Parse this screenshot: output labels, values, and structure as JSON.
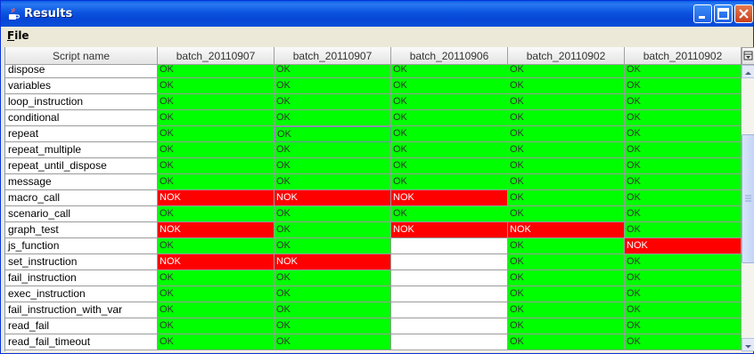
{
  "window": {
    "title": "Results"
  },
  "menu": {
    "file_label": "File",
    "file_mnemonic": "F",
    "file_rest": "ile"
  },
  "table": {
    "name_header": "Script name",
    "columns": [
      "batch_20110907",
      "batch_20110907",
      "batch_20110906",
      "batch_20110902",
      "batch_20110902"
    ],
    "rows": [
      {
        "name": "dispose",
        "cells": [
          "OK",
          "OK",
          "OK",
          "OK",
          "OK"
        ]
      },
      {
        "name": "variables",
        "cells": [
          "OK",
          "OK",
          "OK",
          "OK",
          "OK"
        ]
      },
      {
        "name": "loop_instruction",
        "cells": [
          "OK",
          "OK",
          "OK",
          "OK",
          "OK"
        ]
      },
      {
        "name": "conditional",
        "cells": [
          "OK",
          "OK",
          "OK",
          "OK",
          "OK"
        ]
      },
      {
        "name": "repeat",
        "cells": [
          "OK",
          "OK",
          "OK",
          "OK",
          "OK"
        ]
      },
      {
        "name": "repeat_multiple",
        "cells": [
          "OK",
          "OK",
          "OK",
          "OK",
          "OK"
        ]
      },
      {
        "name": "repeat_until_dispose",
        "cells": [
          "OK",
          "OK",
          "OK",
          "OK",
          "OK"
        ]
      },
      {
        "name": "message",
        "cells": [
          "OK",
          "OK",
          "OK",
          "OK",
          "OK"
        ]
      },
      {
        "name": "macro_call",
        "cells": [
          "NOK",
          "NOK",
          "NOK",
          "OK",
          "OK"
        ]
      },
      {
        "name": "scenario_call",
        "cells": [
          "OK",
          "OK",
          "OK",
          "OK",
          "OK"
        ]
      },
      {
        "name": "graph_test",
        "cells": [
          "NOK",
          "OK",
          "NOK",
          "NOK",
          "OK"
        ]
      },
      {
        "name": "js_function",
        "cells": [
          "OK",
          "OK",
          "",
          "OK",
          "NOK"
        ]
      },
      {
        "name": "set_instruction",
        "cells": [
          "NOK",
          "NOK",
          "",
          "OK",
          "OK"
        ]
      },
      {
        "name": "fail_instruction",
        "cells": [
          "OK",
          "OK",
          "",
          "OK",
          "OK"
        ]
      },
      {
        "name": "exec_instruction",
        "cells": [
          "OK",
          "OK",
          "",
          "OK",
          "OK"
        ]
      },
      {
        "name": "fail_instruction_with_var",
        "cells": [
          "OK",
          "OK",
          "",
          "OK",
          "OK"
        ]
      },
      {
        "name": "read_fail",
        "cells": [
          "OK",
          "OK",
          "",
          "OK",
          "OK"
        ]
      },
      {
        "name": "read_fail_timeout",
        "cells": [
          "OK",
          "OK",
          "",
          "OK",
          "OK"
        ]
      }
    ]
  },
  "colors": {
    "ok": "#00ff00",
    "nok": "#ff0000",
    "titlebar": "#0746d6"
  }
}
